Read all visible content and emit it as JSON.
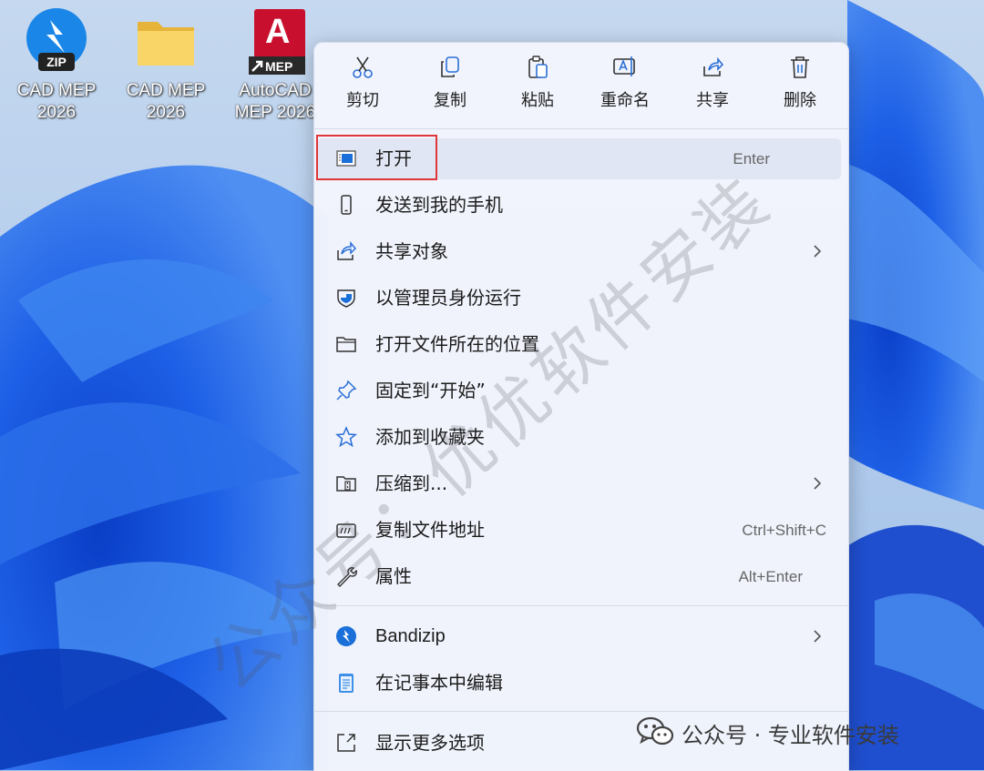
{
  "desktop": {
    "icons": [
      {
        "label_line1": "CAD MEP",
        "label_line2": "2026",
        "badge": "ZIP",
        "icon": "bandizip-zip-icon"
      },
      {
        "label_line1": "CAD MEP",
        "label_line2": "2026",
        "icon": "folder-icon"
      },
      {
        "label_line1": "AutoCAD",
        "label_line2": "MEP 2026",
        "badge": "MEP",
        "letter": "A",
        "icon": "autocad-mep-icon"
      }
    ]
  },
  "context_menu": {
    "toolbar": [
      {
        "label": "剪切",
        "icon": "scissors-icon"
      },
      {
        "label": "复制",
        "icon": "copy-icon"
      },
      {
        "label": "粘贴",
        "icon": "paste-icon"
      },
      {
        "label": "重命名",
        "icon": "rename-icon"
      },
      {
        "label": "共享",
        "icon": "share-icon"
      },
      {
        "label": "删除",
        "icon": "trash-icon"
      }
    ],
    "items": [
      {
        "label": "打开",
        "shortcut": "Enter",
        "icon": "open-app-icon"
      },
      {
        "label": "发送到我的手机",
        "icon": "phone-icon"
      },
      {
        "label": "共享对象",
        "icon": "share-icon",
        "submenu": true
      },
      {
        "label": "以管理员身份运行",
        "icon": "shield-icon"
      },
      {
        "label": "打开文件所在的位置",
        "icon": "folder-icon"
      },
      {
        "label": "固定到“开始”",
        "icon": "pin-icon"
      },
      {
        "label": "添加到收藏夹",
        "icon": "star-icon"
      },
      {
        "label": "压缩到...",
        "icon": "zip-folder-icon",
        "submenu": true
      },
      {
        "label": "复制文件地址",
        "shortcut": "Ctrl+Shift+C",
        "icon": "copy-path-icon"
      },
      {
        "label": "属性",
        "shortcut": "Alt+Enter",
        "icon": "wrench-icon"
      },
      {
        "label": "Bandizip",
        "icon": "bandizip-icon",
        "submenu": true
      },
      {
        "label": "在记事本中编辑",
        "icon": "notepad-icon"
      },
      {
        "label": "显示更多选项",
        "icon": "more-options-icon"
      }
    ]
  },
  "watermark": "公众号：优优软件安装",
  "footer_mark": {
    "text": "公众号 · 专业软件安装",
    "icon": "wechat-icon"
  },
  "colors": {
    "highlight_box": "#e0363a",
    "accent": "#1a6fd8"
  }
}
